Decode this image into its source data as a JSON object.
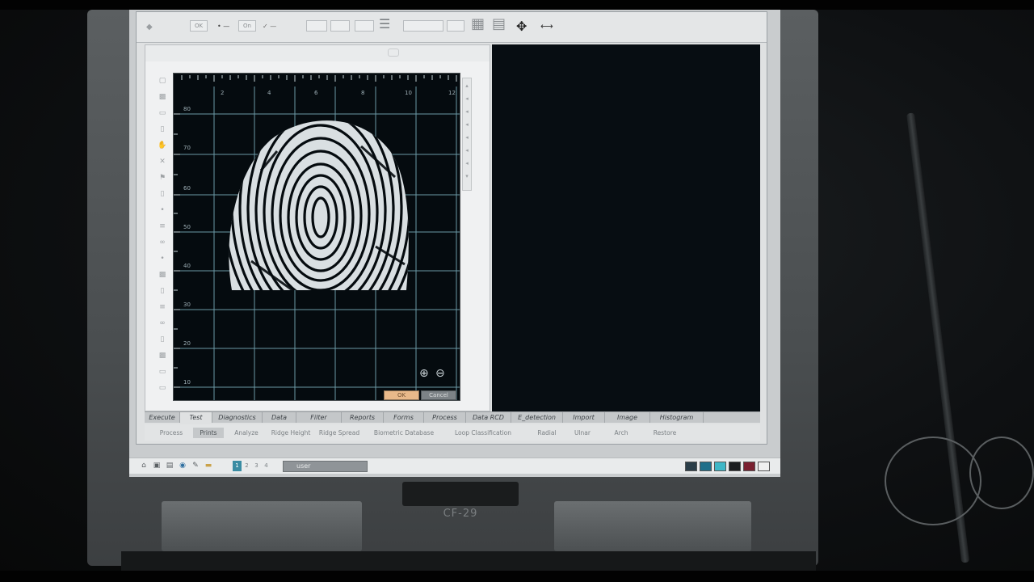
{
  "device": {
    "model": "CF-29"
  },
  "toolbar": {
    "buttons": [
      "OK",
      "On"
    ],
    "icons": [
      "wizard-icon",
      "move-arrows-icon",
      "measure-icon",
      "grid-icon"
    ]
  },
  "viewer": {
    "ruler_top": [
      "2",
      "4",
      "6",
      "8",
      "10",
      "12"
    ],
    "ruler_left": [
      "80",
      "70",
      "60",
      "50",
      "40",
      "30",
      "20",
      "10"
    ],
    "image": "fingerprint",
    "ok_label": "OK",
    "cancel_label": "Cancel",
    "icons": [
      "zoom-in-icon",
      "zoom-out-icon"
    ]
  },
  "tabs": {
    "items": [
      "Execute",
      "Test",
      "Diagnostics",
      "Data",
      "Filter",
      "Reports",
      "Forms",
      "Process",
      "Data RCD",
      "E_detection",
      "Import",
      "Image",
      "Histogram"
    ],
    "active": "Test"
  },
  "subtabs": {
    "items": [
      "Process",
      "Prints",
      "Analyze",
      "Ridge Height",
      "Ridge Spread",
      "Biometric Database",
      "Loop Classification",
      "Radial",
      "Ulnar",
      "Arch",
      "Restore"
    ],
    "active": "Prints"
  },
  "taskbar": {
    "pages": [
      "1",
      "2",
      "3",
      "4"
    ],
    "active_page": "1",
    "user_label": "user",
    "tray_colors": [
      "#2a3d48",
      "#1f6f8a",
      "#3fb7c7",
      "#1b1d1f",
      "#7a2030",
      "#f0f0f0"
    ]
  }
}
